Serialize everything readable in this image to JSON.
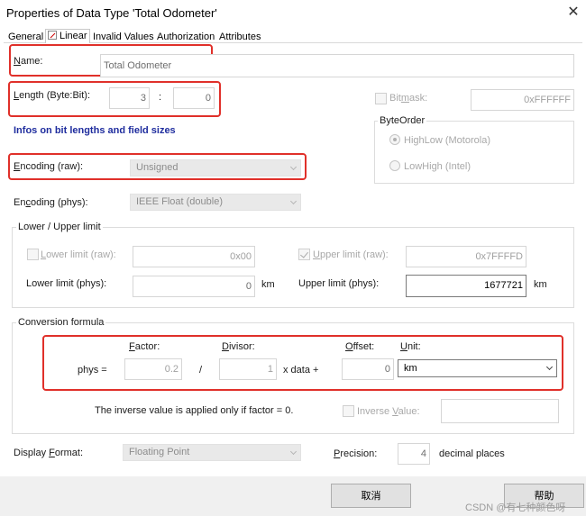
{
  "window": {
    "title": "Properties of Data Type 'Total Odometer'",
    "close_glyph": "✕"
  },
  "tabs": [
    "General",
    "Linear",
    "Invalid Values",
    "Authorization",
    "Attributes"
  ],
  "name": {
    "label": "Name:",
    "value": "Total Odometer"
  },
  "length": {
    "label": "Length (Byte:Bit):",
    "byte": "3",
    "sep": ":",
    "bit": "0"
  },
  "bitmask": {
    "label": "Bitmask:",
    "value": "0xFFFFFF"
  },
  "info_link": "Infos on bit lengths and field sizes",
  "byteorder": {
    "title": "ByteOrder",
    "options": [
      "HighLow (Motorola)",
      "LowHigh (Intel)"
    ],
    "selected": "HighLow (Motorola)"
  },
  "encoding_raw": {
    "label": "Encoding (raw):",
    "value": "Unsigned"
  },
  "encoding_phys": {
    "label": "Encoding (phys):",
    "value": "IEEE Float (double)"
  },
  "limits": {
    "title": "Lower / Upper limit",
    "lower_raw_label": "Lower limit (raw):",
    "lower_raw": "0x00",
    "upper_raw_label": "Upper limit (raw):",
    "upper_raw": "0x7FFFFD",
    "lower_phys_label": "Lower limit (phys):",
    "lower_phys": "0",
    "lower_phys_unit": "km",
    "upper_phys_label": "Upper limit (phys):",
    "upper_phys": "1677721",
    "upper_phys_unit": "km"
  },
  "conversion": {
    "title": "Conversion formula",
    "factor_label": "Factor:",
    "divisor_label": "Divisor:",
    "offset_label": "Offset:",
    "unit_label": "Unit:",
    "phys_eq": "phys  =",
    "factor": "0.2",
    "div_op": "/",
    "divisor": "1",
    "x_data": "x  data  +",
    "offset": "0",
    "unit": "km",
    "note": "The inverse value is applied only if factor = 0.",
    "inverse_label": "Inverse Value:"
  },
  "display": {
    "label": "Display Format:",
    "value": "Floating Point",
    "precision_label": "Precision:",
    "precision": "4",
    "precision_unit": "decimal places"
  },
  "buttons": {
    "cancel": "取消",
    "help": "帮助"
  },
  "watermark": "CSDN @有七种颜色呀"
}
